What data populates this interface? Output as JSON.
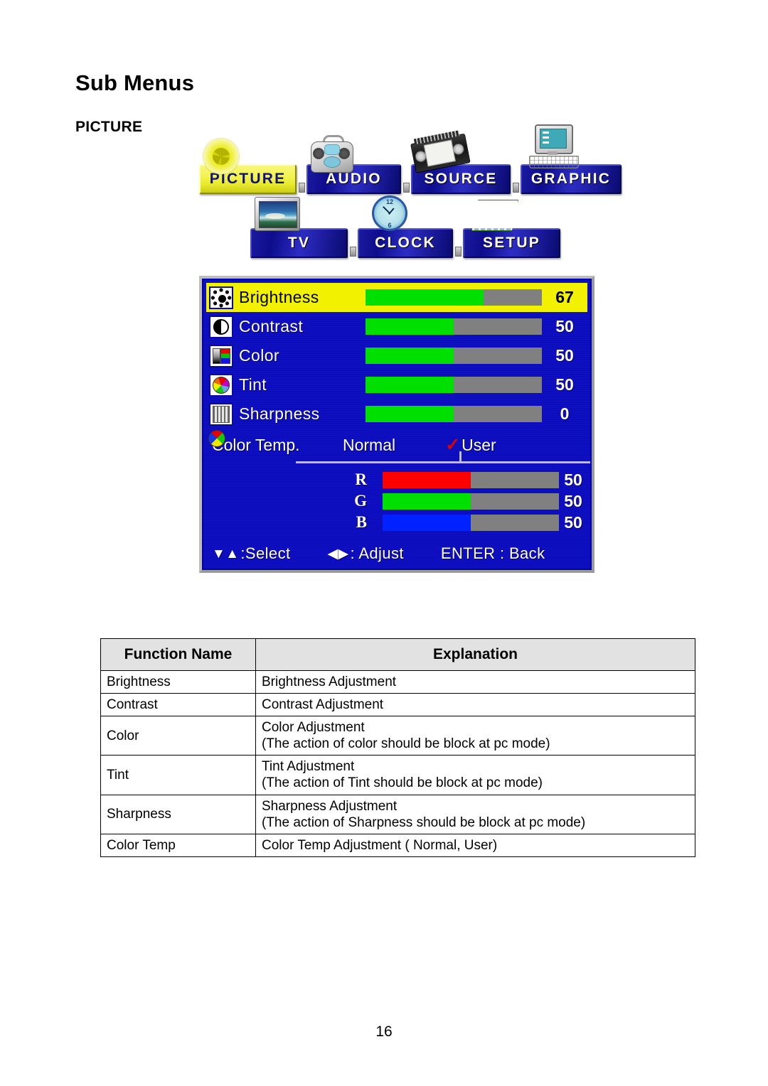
{
  "document": {
    "page_title": "Sub Menus",
    "section_title": "PICTURE",
    "page_number": "16"
  },
  "osd": {
    "tabs_row1": [
      {
        "label": "PICTURE",
        "icon": "sun-lamp-icon",
        "active": true
      },
      {
        "label": "AUDIO",
        "icon": "boombox-icon",
        "active": false
      },
      {
        "label": "SOURCE",
        "icon": "vhs-cassette-icon",
        "active": false
      },
      {
        "label": "GRAPHIC",
        "icon": "computer-monitor-icon",
        "active": false
      }
    ],
    "tabs_row2": [
      {
        "label": "TV",
        "icon": "television-icon",
        "active": false
      },
      {
        "label": "CLOCK",
        "icon": "clock-icon",
        "active": false
      },
      {
        "label": "SETUP",
        "icon": "keypad-icon",
        "active": false
      }
    ],
    "rows": [
      {
        "name": "Brightness",
        "icon": "brightness-icon",
        "value": "67",
        "percent": 67,
        "selected": true,
        "fill_color": "#00e000"
      },
      {
        "name": "Contrast",
        "icon": "contrast-icon",
        "value": "50",
        "percent": 50,
        "selected": false,
        "fill_color": "#00e000"
      },
      {
        "name": "Color",
        "icon": "color-bars-icon",
        "value": "50",
        "percent": 50,
        "selected": false,
        "fill_color": "#00e000"
      },
      {
        "name": "Tint",
        "icon": "color-wheel-icon",
        "value": "50",
        "percent": 50,
        "selected": false,
        "fill_color": "#00e000"
      },
      {
        "name": "Sharpness",
        "icon": "grid-icon",
        "value": "0",
        "percent": 50,
        "selected": false,
        "fill_color": "#00e000"
      }
    ],
    "color_temp": {
      "name": "Color Temp.",
      "icon": "color-temp-icon",
      "option_normal": "Normal",
      "option_user": "User",
      "checkmark": "✓",
      "selected_option": "User"
    },
    "rgb": [
      {
        "channel": "R",
        "value": "50",
        "percent": 50,
        "fill_color": "#ff0000"
      },
      {
        "channel": "G",
        "value": "50",
        "percent": 50,
        "fill_color": "#00e000"
      },
      {
        "channel": "B",
        "value": "50",
        "percent": 50,
        "fill_color": "#0022ff"
      }
    ],
    "hints": {
      "select_arrows": "▼▲",
      "select_label": ":Select",
      "adjust_arrows": "◀▶",
      "adjust_label": ": Adjust",
      "back_label": "ENTER : Back"
    },
    "colors": {
      "panel_background": "#0c0cc0",
      "selected_row": "#f2f200",
      "bar_track": "#808080",
      "bar_fill_green": "#00e000",
      "checkmark_red": "#e00000"
    }
  },
  "table": {
    "headers": [
      "Function Name",
      "Explanation"
    ],
    "rows": [
      {
        "fn": "Brightness",
        "exp_line1": "Brightness Adjustment",
        "exp_line2": ""
      },
      {
        "fn": "Contrast",
        "exp_line1": "Contrast Adjustment",
        "exp_line2": ""
      },
      {
        "fn": "Color",
        "exp_line1": "Color Adjustment",
        "exp_line2": "(The action of color should be block at pc mode)"
      },
      {
        "fn": "Tint",
        "exp_line1": "Tint Adjustment",
        "exp_line2": "(The action of Tint should be block at pc mode)"
      },
      {
        "fn": "Sharpness",
        "exp_line1": "Sharpness Adjustment",
        "exp_line2": "(The action of Sharpness should be block at pc mode)"
      },
      {
        "fn": "Color Temp",
        "exp_line1": "Color Temp Adjustment ( Normal, User)",
        "exp_line2": ""
      }
    ]
  }
}
